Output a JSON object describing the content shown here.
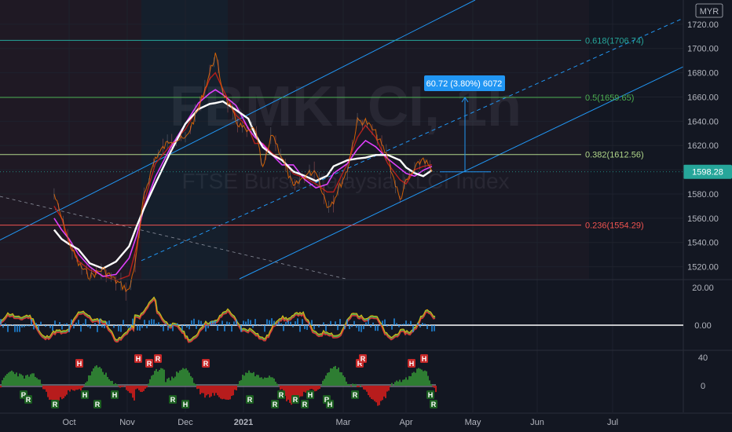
{
  "chart_data": {
    "type": "line",
    "watermark": {
      "symbol": "FBMKLCI, 1h",
      "name": "FTSE Bursa Malaysia KLCI Index"
    },
    "currency_badge": "MYR",
    "x_ticks": [
      "Oct",
      "Nov",
      "Dec",
      "2021",
      "Mar",
      "Apr",
      "May",
      "Jun",
      "Jul"
    ],
    "y_ticks": [
      "1720.00",
      "1700.00",
      "1680.00",
      "1660.00",
      "1640.00",
      "1620.00",
      "1600.00",
      "1580.00",
      "1560.00",
      "1540.00",
      "1520.00"
    ],
    "ylim": [
      1510,
      1740
    ],
    "last_price": "1598.28",
    "last_price_value": 1598.28,
    "fib_levels": [
      {
        "label": "0.618(1706.74)",
        "value": 1706.74,
        "color": "#26a69a"
      },
      {
        "label": "0.5(1659.65)",
        "value": 1659.65,
        "color": "#4caf50"
      },
      {
        "label": "0.382(1612.56)",
        "value": 1612.56,
        "color": "#b0d68a"
      },
      {
        "label": "0.236(1554.29)",
        "value": 1554.29,
        "color": "#ef5350"
      }
    ],
    "measure_tooltip": "60.72 (3.80%) 6072",
    "price_series": {
      "name": "",
      "points": [
        [
          "Sep 24",
          1580
        ],
        [
          "Sep 28",
          1560
        ],
        [
          "Oct 1",
          1540
        ],
        [
          "Oct 6",
          1522
        ],
        [
          "Oct 12",
          1512
        ],
        [
          "Oct 19",
          1518
        ],
        [
          "Oct 26",
          1508
        ],
        [
          "Nov 2",
          1500
        ],
        [
          "Nov 6",
          1530
        ],
        [
          "Nov 10",
          1580
        ],
        [
          "Nov 16",
          1610
        ],
        [
          "Nov 24",
          1625
        ],
        [
          "Dec 1",
          1625
        ],
        [
          "Dec 8",
          1650
        ],
        [
          "Dec 14",
          1680
        ],
        [
          "Dec 17",
          1695
        ],
        [
          "Dec 21",
          1665
        ],
        [
          "Dec 28",
          1640
        ],
        [
          "Jan 4",
          1630
        ],
        [
          "Jan 8",
          1635
        ],
        [
          "Jan 13",
          1600
        ],
        [
          "Jan 19",
          1630
        ],
        [
          "Jan 25",
          1610
        ],
        [
          "Feb 1",
          1585
        ],
        [
          "Feb 8",
          1595
        ],
        [
          "Feb 15",
          1600
        ],
        [
          "Feb 22",
          1570
        ],
        [
          "Feb 26",
          1575
        ],
        [
          "Mar 3",
          1600
        ],
        [
          "Mar 8",
          1640
        ],
        [
          "Mar 12",
          1640
        ],
        [
          "Mar 17",
          1630
        ],
        [
          "Mar 23",
          1610
        ],
        [
          "Mar 29",
          1575
        ],
        [
          "Apr 1",
          1590
        ],
        [
          "Apr 5",
          1600
        ],
        [
          "Apr 9",
          1610
        ],
        [
          "Apr 13",
          1598.28
        ]
      ]
    },
    "oscillator_1": {
      "y_ticks": [
        "20.00",
        "0.00"
      ]
    },
    "oscillator_2": {
      "y_ticks": [
        "40",
        "0"
      ],
      "markers": [
        {
          "label": "R",
          "type": "bull"
        },
        {
          "label": "R",
          "type": "bull"
        },
        {
          "label": "R",
          "type": "bull"
        },
        {
          "label": "H",
          "type": "bull"
        },
        {
          "label": "H",
          "type": "bear"
        },
        {
          "label": "R",
          "type": "bull"
        },
        {
          "label": "H",
          "type": "bull"
        },
        {
          "label": "H",
          "type": "bear"
        },
        {
          "label": "R",
          "type": "bear"
        },
        {
          "label": "R",
          "type": "bear"
        },
        {
          "label": "R",
          "type": "bull"
        },
        {
          "label": "H",
          "type": "bull"
        },
        {
          "label": "R",
          "type": "bear"
        },
        {
          "label": "R",
          "type": "bull"
        },
        {
          "label": "R",
          "type": "bull"
        },
        {
          "label": "R",
          "type": "bull"
        },
        {
          "label": "R",
          "type": "bull"
        },
        {
          "label": "R",
          "type": "bull"
        },
        {
          "label": "H",
          "type": "bull"
        },
        {
          "label": "R",
          "type": "bull"
        },
        {
          "label": "H",
          "type": "bull"
        },
        {
          "label": "R",
          "type": "bull"
        },
        {
          "label": "R",
          "type": "bear"
        },
        {
          "label": "R",
          "type": "bear"
        },
        {
          "label": "H",
          "type": "bear"
        },
        {
          "label": "H",
          "type": "bear"
        },
        {
          "label": "R",
          "type": "bull"
        },
        {
          "label": "H",
          "type": "bull"
        }
      ]
    },
    "colors": {
      "background": "#131722",
      "grid": "#1e222d",
      "channel": "#2196f3",
      "price": "#ef6c00",
      "ema_white": "#ffffff",
      "ema_magenta": "#e040fb",
      "ema_red": "#b71c1c",
      "ema_green": "#1b5e20",
      "measure": "#2196f3"
    }
  }
}
